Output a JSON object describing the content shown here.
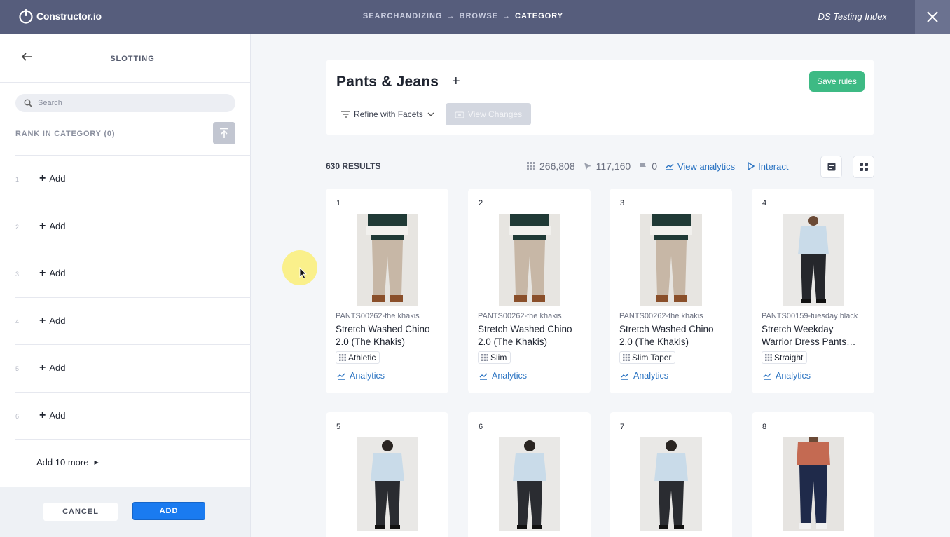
{
  "topbar": {
    "logo_text": "Constructor.io",
    "breadcrumb": [
      "SEARCHANDIZING",
      "BROWSE",
      "CATEGORY"
    ],
    "breadcrumb_sep": "→",
    "index_name": "DS Testing Index"
  },
  "sidebar": {
    "title": "SLOTTING",
    "search_placeholder": "Search",
    "rank_label": "RANK IN CATEGORY (0)",
    "slots": [
      {
        "num": "1",
        "label": "Add"
      },
      {
        "num": "2",
        "label": "Add"
      },
      {
        "num": "3",
        "label": "Add"
      },
      {
        "num": "4",
        "label": "Add"
      },
      {
        "num": "5",
        "label": "Add"
      },
      {
        "num": "6",
        "label": "Add"
      }
    ],
    "add_more": "Add 10 more",
    "cancel": "CANCEL",
    "add": "ADD"
  },
  "header": {
    "title": "Pants & Jeans",
    "refine": "Refine with Facets",
    "view_changes": "View Changes",
    "save_rules": "Save rules"
  },
  "results": {
    "count": "630 RESULTS",
    "stat_views": "266,808",
    "stat_clicks": "117,160",
    "stat_flags": "0",
    "view_analytics": "View analytics",
    "interact": "Interact"
  },
  "products": [
    {
      "pos": "1",
      "sku": "PANTS00262-the khakis",
      "name": "Stretch Washed Chino 2.0 (The Khakis)",
      "tag": "Athletic",
      "analytics": "Analytics"
    },
    {
      "pos": "2",
      "sku": "PANTS00262-the khakis",
      "name": "Stretch Washed Chino 2.0 (The Khakis)",
      "tag": "Slim",
      "analytics": "Analytics"
    },
    {
      "pos": "3",
      "sku": "PANTS00262-the khakis",
      "name": "Stretch Washed Chino 2.0 (The Khakis)",
      "tag": "Slim Taper",
      "analytics": "Analytics"
    },
    {
      "pos": "4",
      "sku": "PANTS00159-tuesday black",
      "name": "Stretch Weekday Warrior Dress Pants…",
      "tag": "Straight",
      "analytics": "Analytics"
    },
    {
      "pos": "5"
    },
    {
      "pos": "6"
    },
    {
      "pos": "7"
    },
    {
      "pos": "8"
    }
  ],
  "colors": {
    "topbar": "#565d7c",
    "accent_blue": "#1a7bf0",
    "save_green": "#3dba84",
    "link_blue": "#2a73c2"
  }
}
